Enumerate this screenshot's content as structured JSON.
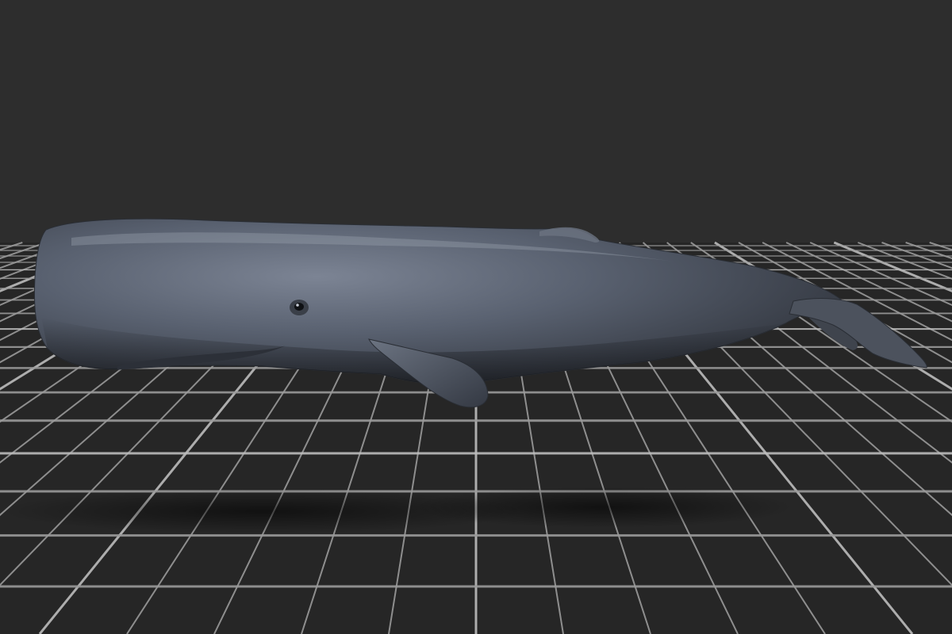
{
  "viewport": {
    "background_color": "#2d2d2d",
    "floor_color": "#262626",
    "grid_line_color": "#9a9a9a",
    "grid_major_line_color": "#bdbdbd",
    "view": "perspective"
  },
  "model": {
    "subject": "sperm whale",
    "skin_color": "#596170",
    "shadow_color": "#141414"
  },
  "icons": {
    "floor": "grid-floor-icon",
    "model": "whale-model-icon"
  }
}
